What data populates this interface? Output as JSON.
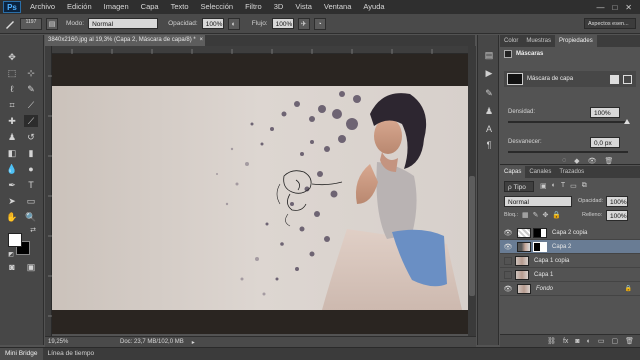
{
  "menubar": {
    "logo": "Ps",
    "items": [
      "Archivo",
      "Edición",
      "Imagen",
      "Capa",
      "Texto",
      "Selección",
      "Filtro",
      "3D",
      "Vista",
      "Ventana",
      "Ayuda"
    ],
    "win_min": "—",
    "win_max": "□",
    "win_close": "✕"
  },
  "options": {
    "brush_size": "1197",
    "mode_label": "Modo:",
    "mode_value": "Normal",
    "opacity_label": "Opacidad:",
    "opacity_value": "100%",
    "flow_label": "Flujo:",
    "flow_value": "100%",
    "workspace_value": "Aspectos esen..."
  },
  "document": {
    "tab_title": "3840x2160.jpg al 19,3% (Capa 2, Máscara de capa/8) *",
    "tab_close": "×",
    "zoom": "19,25%",
    "doc_info": "Doc: 23,7 MB/102,0 MB"
  },
  "bottom_tabs": [
    "Mini Bridge",
    "Línea de tiempo"
  ],
  "properties": {
    "tabs": [
      "Color",
      "Muestras",
      "Propiedades"
    ],
    "active_tab": "Propiedades",
    "section": "Máscaras",
    "mask_label": "Máscara de capa",
    "density_label": "Densidad:",
    "density_value": "100%",
    "feather_label": "Desvanecer:",
    "feather_value": "0,0 px"
  },
  "layers": {
    "tabs": [
      "Capas",
      "Canales",
      "Trazados"
    ],
    "active_tab": "Capas",
    "filter_value": "ρ Tipo",
    "blend_value": "Normal",
    "opacity_label": "Opacidad:",
    "opacity_value": "100%",
    "lock_label": "Bloq.:",
    "fill_label": "Relleno:",
    "fill_value": "100%",
    "rows": [
      {
        "name": "Capa 2 copia",
        "visible": true,
        "selected": false
      },
      {
        "name": "Capa 2",
        "visible": true,
        "selected": true
      },
      {
        "name": "Capa 1 copia",
        "visible": false,
        "selected": false
      },
      {
        "name": "Capa 1",
        "visible": false,
        "selected": false
      },
      {
        "name": "Fondo",
        "visible": true,
        "selected": false
      }
    ],
    "footer_icons": [
      "link-icon",
      "fx-icon",
      "mask-icon",
      "adjust-icon",
      "folder-icon",
      "new-layer-icon",
      "trash-icon"
    ]
  },
  "colors": {
    "selected_layer": "#697c94",
    "panel_bg": "#535353",
    "menubar_bg": "#2f2f2f",
    "skirt_blue": "#6a8fc4"
  }
}
